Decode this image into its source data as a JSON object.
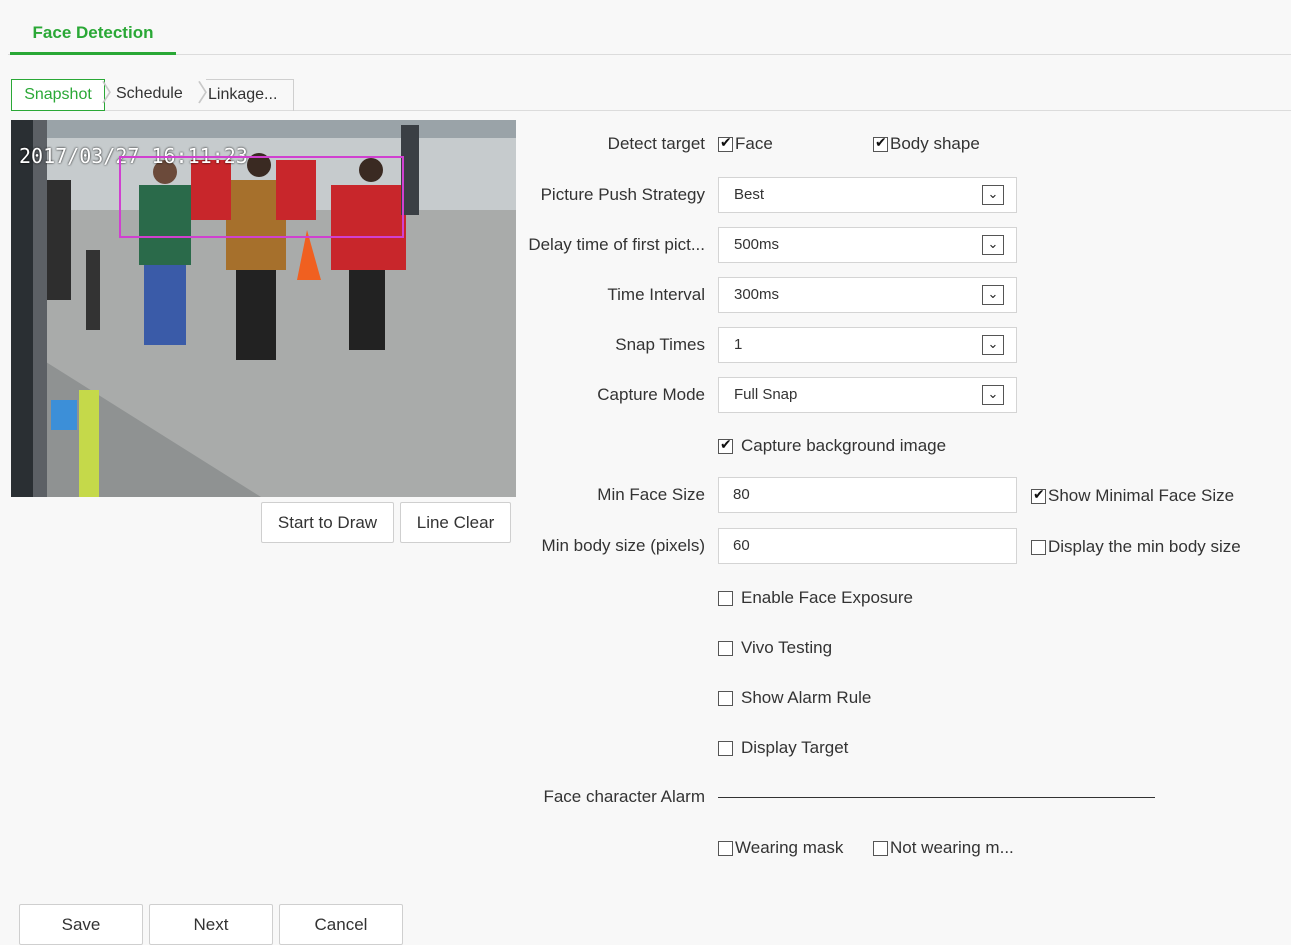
{
  "header": {
    "tab": "Face Detection"
  },
  "subtabs": [
    "Snapshot",
    "Schedule",
    "Linkage..."
  ],
  "video": {
    "timestamp": "2017/03/27 16:11:23"
  },
  "draw_buttons": {
    "start": "Start to Draw",
    "clear": "Line Clear"
  },
  "form": {
    "detect_target": {
      "label": "Detect target",
      "face": "Face",
      "body": "Body shape",
      "face_checked": true,
      "body_checked": true
    },
    "push_strategy": {
      "label": "Picture Push Strategy",
      "value": "Best"
    },
    "delay": {
      "label": "Delay time of first pict...",
      "value": "500ms"
    },
    "interval": {
      "label": "Time Interval",
      "value": "300ms"
    },
    "snap_times": {
      "label": "Snap Times",
      "value": "1"
    },
    "capture_mode": {
      "label": "Capture Mode",
      "value": "Full Snap"
    },
    "capture_bg": {
      "label": "Capture background image",
      "checked": true
    },
    "min_face": {
      "label": "Min Face Size",
      "value": "80",
      "show_label": "Show Minimal Face Size",
      "show_checked": true
    },
    "min_body": {
      "label": "Min body size (pixels)",
      "value": "60",
      "show_label": "Display the min body size",
      "show_checked": false
    },
    "face_exposure": {
      "label": "Enable Face Exposure",
      "checked": false
    },
    "vivo": {
      "label": "Vivo Testing",
      "checked": false
    },
    "alarm_rule": {
      "label": "Show Alarm Rule",
      "checked": false
    },
    "display_target": {
      "label": "Display Target",
      "checked": false
    },
    "face_char_alarm": {
      "label": "Face character Alarm"
    },
    "mask": {
      "wearing": "Wearing mask",
      "not_wearing": "Not wearing m..."
    }
  },
  "footer": {
    "save": "Save",
    "next": "Next",
    "cancel": "Cancel"
  },
  "colors": {
    "accent": "#2aa836",
    "detection_box": "#d040d0"
  }
}
